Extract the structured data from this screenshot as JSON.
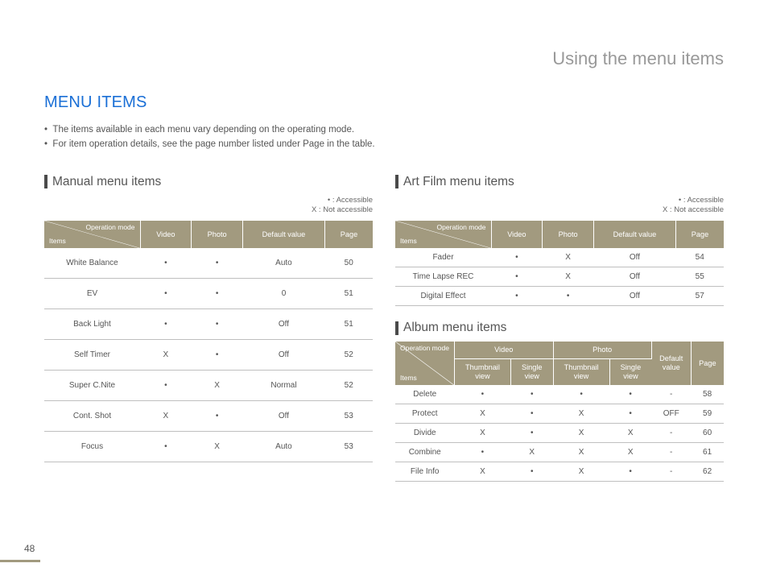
{
  "pageTitle": "Using the menu items",
  "mainHeading": "MENU ITEMS",
  "bullets": [
    "The items available in each menu vary depending on the operating mode.",
    "For item operation details, see the page number listed under Page in the table."
  ],
  "legend": {
    "line1": "• : Accessible",
    "line2": "X : Not accessible"
  },
  "cornerTop": "Operation mode",
  "cornerBottom": "Items",
  "manual": {
    "title": "Manual menu items",
    "headers": [
      "Video",
      "Photo",
      "Default value",
      "Page"
    ],
    "rows": [
      [
        "White Balance",
        "•",
        "•",
        "Auto",
        "50"
      ],
      [
        "EV",
        "•",
        "•",
        "0",
        "51"
      ],
      [
        "Back Light",
        "•",
        "•",
        "Off",
        "51"
      ],
      [
        "Self Timer",
        "X",
        "•",
        "Off",
        "52"
      ],
      [
        "Super C.Nite",
        "•",
        "X",
        "Normal",
        "52"
      ],
      [
        "Cont. Shot",
        "X",
        "•",
        "Off",
        "53"
      ],
      [
        "Focus",
        "•",
        "X",
        "Auto",
        "53"
      ]
    ]
  },
  "artfilm": {
    "title": "Art Film menu items",
    "headers": [
      "Video",
      "Photo",
      "Default value",
      "Page"
    ],
    "rows": [
      [
        "Fader",
        "•",
        "X",
        "Off",
        "54"
      ],
      [
        "Time Lapse REC",
        "•",
        "X",
        "Off",
        "55"
      ],
      [
        "Digital Effect",
        "•",
        "•",
        "Off",
        "57"
      ]
    ]
  },
  "album": {
    "title": "Album menu items",
    "topHeaders": [
      "Video",
      "Photo",
      "Default value",
      "Page"
    ],
    "subHeaders": [
      "Thumbnail view",
      "Single view",
      "Thumbnail view",
      "Single view"
    ],
    "rows": [
      [
        "Delete",
        "•",
        "•",
        "•",
        "•",
        "-",
        "58"
      ],
      [
        "Protect",
        "X",
        "•",
        "X",
        "•",
        "OFF",
        "59"
      ],
      [
        "Divide",
        "X",
        "•",
        "X",
        "X",
        "-",
        "60"
      ],
      [
        "Combine",
        "•",
        "X",
        "X",
        "X",
        "-",
        "61"
      ],
      [
        "File Info",
        "X",
        "•",
        "X",
        "•",
        "-",
        "62"
      ]
    ]
  },
  "pageNumber": "48"
}
